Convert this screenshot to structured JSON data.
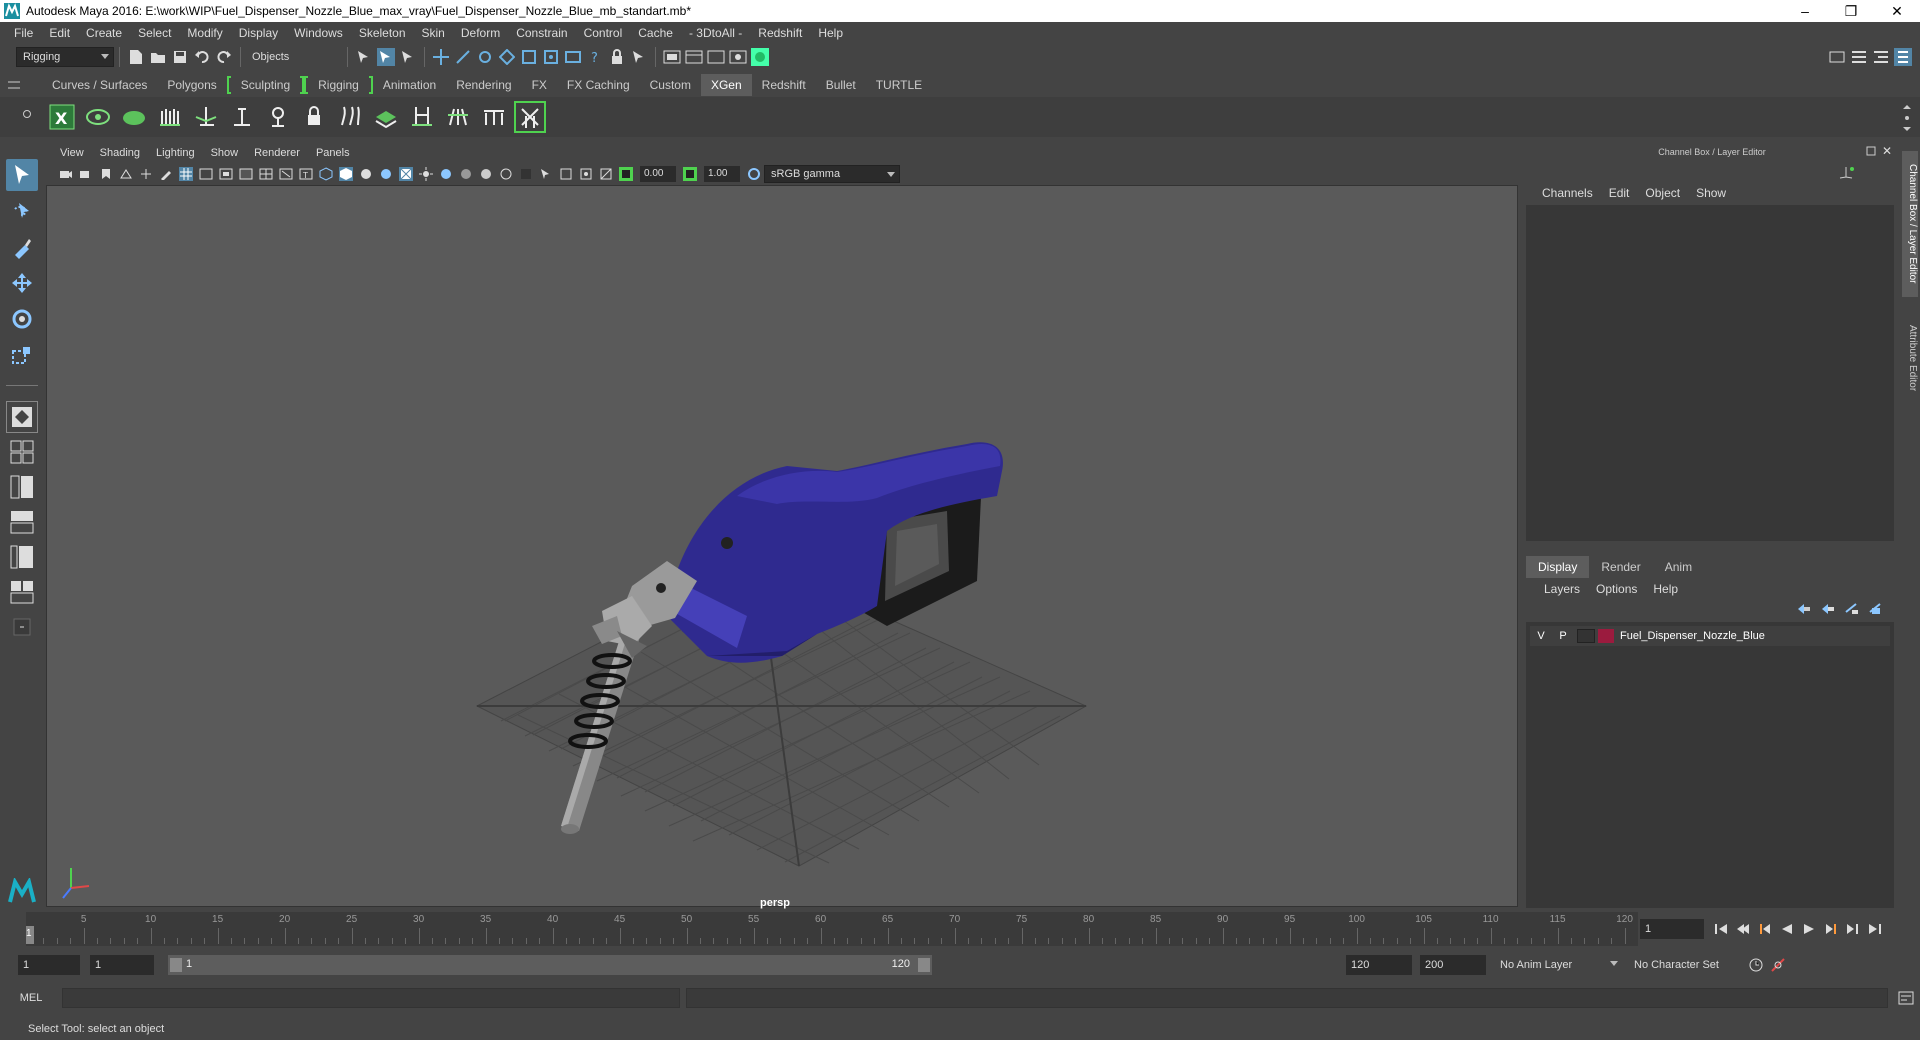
{
  "window": {
    "title": "Autodesk Maya 2016: E:\\work\\WIP\\Fuel_Dispenser_Nozzle_Blue_max_vray\\Fuel_Dispenser_Nozzle_Blue_mb_standart.mb*",
    "minimize": "–",
    "restore": "❐",
    "close": "✕"
  },
  "menubar": [
    "File",
    "Edit",
    "Create",
    "Select",
    "Modify",
    "Display",
    "Windows",
    "Skeleton",
    "Skin",
    "Deform",
    "Constrain",
    "Control",
    "Cache",
    "- 3DtoAll -",
    "Redshift",
    "Help"
  ],
  "statusline": {
    "menuset": "Rigging",
    "select_mode": "Objects"
  },
  "shelf": {
    "tabs": [
      "Curves / Surfaces",
      "Polygons",
      "Sculpting",
      "Rigging",
      "Animation",
      "Rendering",
      "FX",
      "FX Caching",
      "Custom",
      "XGen",
      "Redshift",
      "Bullet",
      "TURTLE"
    ],
    "active_tab": "XGen"
  },
  "viewport": {
    "menu": [
      "View",
      "Shading",
      "Lighting",
      "Show",
      "Renderer",
      "Panels"
    ],
    "exposure": "0.00",
    "gamma": "1.00",
    "color_space": "sRGB gamma",
    "camera_label": "persp"
  },
  "channel_box": {
    "title": "Channel Box / Layer Editor",
    "menu": [
      "Channels",
      "Edit",
      "Object",
      "Show"
    ],
    "side_tabs": [
      "Channel Box / Layer Editor",
      "Attribute Editor"
    ]
  },
  "layer_editor": {
    "tabs": [
      "Display",
      "Render",
      "Anim"
    ],
    "active_tab": "Display",
    "menu": [
      "Layers",
      "Options",
      "Help"
    ],
    "layers": [
      {
        "visible": "V",
        "playback": "P",
        "name": "Fuel_Dispenser_Nozzle_Blue",
        "color": "#9b1b3e"
      }
    ]
  },
  "time_slider": {
    "ticks": [
      "5",
      "10",
      "15",
      "20",
      "25",
      "30",
      "35",
      "40",
      "45",
      "50",
      "55",
      "60",
      "65",
      "70",
      "75",
      "80",
      "85",
      "90",
      "95",
      "100",
      "105",
      "110",
      "115",
      "120"
    ],
    "current_frame_label": "1",
    "current_frame_field": "1"
  },
  "range_slider": {
    "start_time": "1",
    "playback_start": "1",
    "range_start_label": "1",
    "range_end_label": "120",
    "playback_end": "120",
    "end_time": "200",
    "anim_layer": "No Anim Layer",
    "character_set": "No Character Set"
  },
  "command_line": {
    "label": "MEL",
    "help_text": "Select Tool: select an object"
  },
  "colors": {
    "active_blue": "#5285a6",
    "shelf_green": "#4fd24f",
    "nozzle_blue": "#2f2a8f",
    "layer_color": "#9b1b3e"
  }
}
